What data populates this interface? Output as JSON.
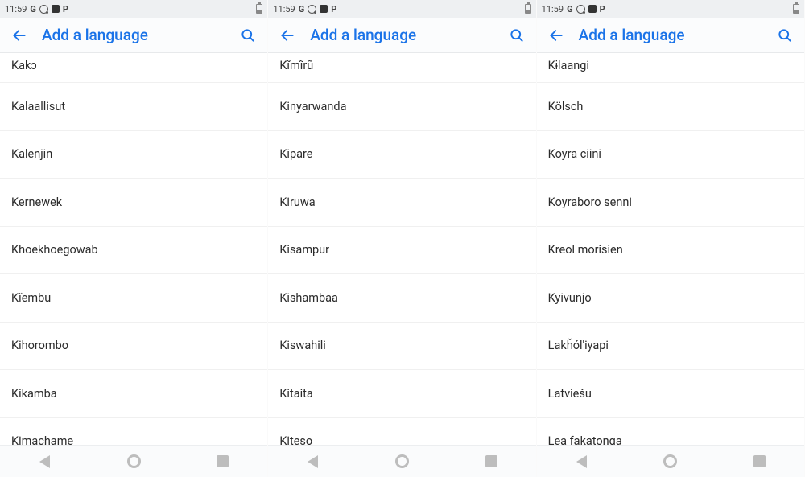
{
  "panels": [
    {
      "status": {
        "time": "11:59",
        "g": "G",
        "p": "P"
      },
      "appbar": {
        "title": "Add a language"
      },
      "items": [
        "Kakɔ",
        "Kalaallisut",
        "Kalenjin",
        "Kernewek",
        "Khoekhoegowab",
        "Kĩembu",
        "Kihorombo",
        "Kikamba",
        "Kimachame"
      ]
    },
    {
      "status": {
        "time": "11:59",
        "g": "G",
        "p": "P"
      },
      "appbar": {
        "title": "Add a language"
      },
      "items": [
        "Kĩmĩrũ",
        "Kinyarwanda",
        "Kipare",
        "Kiruwa",
        "Kisampur",
        "Kishambaa",
        "Kiswahili",
        "Kitaita",
        "Kiteso"
      ]
    },
    {
      "status": {
        "time": "11:59",
        "g": "G",
        "p": "P"
      },
      "appbar": {
        "title": "Add a language"
      },
      "items": [
        "Kɨlaangi",
        "Kölsch",
        "Koyra ciini",
        "Koyraboro senni",
        "Kreol morisien",
        "Kyivunjo",
        "Lakȟól'iyapi",
        "Latviešu",
        "Lea fakatonga"
      ]
    }
  ]
}
